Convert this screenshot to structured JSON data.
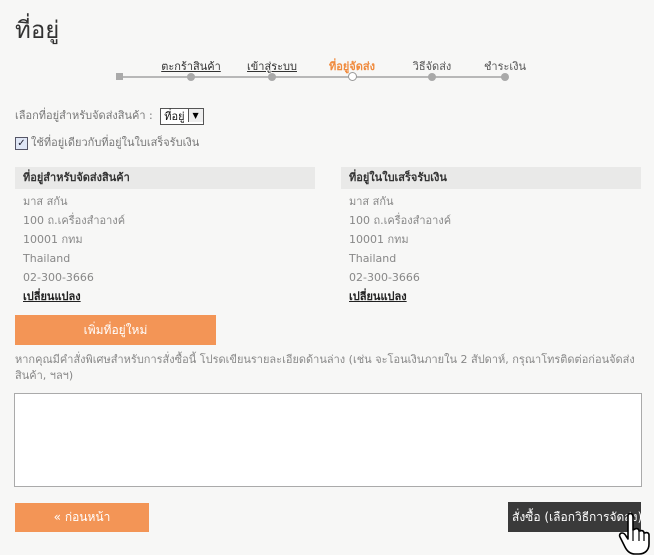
{
  "page": {
    "title": "ที่อยู่"
  },
  "steps": [
    {
      "label": "ตะกร้าสินค้า",
      "state": "link"
    },
    {
      "label": "เข้าสู่ระบบ",
      "state": "link"
    },
    {
      "label": "ที่อยู่จัดส่ง",
      "state": "active"
    },
    {
      "label": "วิธีจัดส่ง",
      "state": "disabled"
    },
    {
      "label": "ชำระเงิน",
      "state": "disabled"
    }
  ],
  "address_select": {
    "label": "เลือกที่อยู่สำหรับจัดส่งสินค้า :",
    "selected": "ที่อยู่"
  },
  "same_address": {
    "label": "ใช้ที่อยู่เดียวกับที่อยู่ในใบเสร็จรับเงิน",
    "checked": true
  },
  "shipping": {
    "heading": "ที่อยู่สำหรับจัดส่งสินค้า",
    "lines": [
      "มาส สกัน",
      "100 ถ.เครื่องสำอางค์",
      "10001 กทม",
      "Thailand",
      "02-300-3666"
    ],
    "change_label": "เปลี่ยนแปลง"
  },
  "billing": {
    "heading": "ที่อยู่ในใบเสร็จรับเงิน",
    "lines": [
      "มาส สกัน",
      "100 ถ.เครื่องสำอางค์",
      "10001 กทม",
      "Thailand",
      "02-300-3666"
    ],
    "change_label": "เปลี่ยนแปลง"
  },
  "add_address_label": "เพิ่มที่อยู่ใหม่",
  "note": "หากคุณมีคำสั่งพิเศษสำหรับการสั่งซื้อนี้ โปรดเขียนรายละเอียดด้านล่าง (เช่น จะโอนเงินภายใน 2 สัปดาห์, กรุณาโทรติดต่อก่อนจัดส่งสินค้า, ฯลฯ)",
  "comment_value": "",
  "back_label": "« ก่อนหน้า",
  "order_label": "สั่งซื้อ (เลือกวิธีการจัดส่ง)",
  "colors": {
    "accent": "#f39556",
    "active_step": "#f08a3c",
    "dark_button": "#3a3a3a"
  }
}
